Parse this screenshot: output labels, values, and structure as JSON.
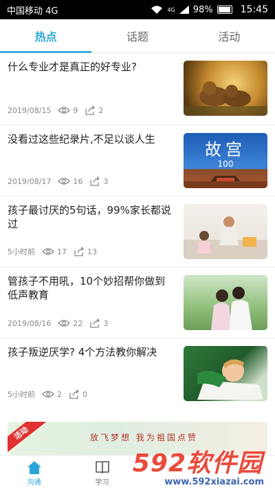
{
  "status_bar": {
    "carrier": "中国移动 4G",
    "signal": "4G",
    "battery": "98%",
    "time": "15:45"
  },
  "tabs": [
    {
      "label": "热点",
      "active": true
    },
    {
      "label": "话题",
      "active": false
    },
    {
      "label": "活动",
      "active": false
    }
  ],
  "news": [
    {
      "title": "什么专业才是真正的好专业?",
      "date": "2019/08/15",
      "views": "9",
      "shares": "2"
    },
    {
      "title": "没看过这些纪录片,不足以谈人生",
      "date": "2019/08/17",
      "views": "16",
      "shares": "3"
    },
    {
      "title": "孩子最讨厌的5句话，99%家长都说过",
      "date": "5小时前",
      "views": "17",
      "shares": "13"
    },
    {
      "title": "管孩子不用吼，10个妙招帮你做到低声教育",
      "date": "2019/08/16",
      "views": "22",
      "shares": "3"
    },
    {
      "title": "孩子叛逆厌学? 4个方法教你解决",
      "date": "5小时前",
      "views": "2",
      "shares": "0"
    }
  ],
  "thumb_text": {
    "forbidden_city_title": "故宫",
    "forbidden_city_num": "100"
  },
  "banner": {
    "ribbon": "活动",
    "text": "放飞梦想 我为祖国点赞"
  },
  "bottom_nav": [
    {
      "label": "沟通",
      "active": true
    },
    {
      "label": "学习",
      "active": false
    }
  ],
  "watermark": {
    "brand": "592软件园",
    "url": "www.592xiazai.com"
  },
  "colors": {
    "accent": "#2aa7d8",
    "status_bg": "#000000"
  }
}
